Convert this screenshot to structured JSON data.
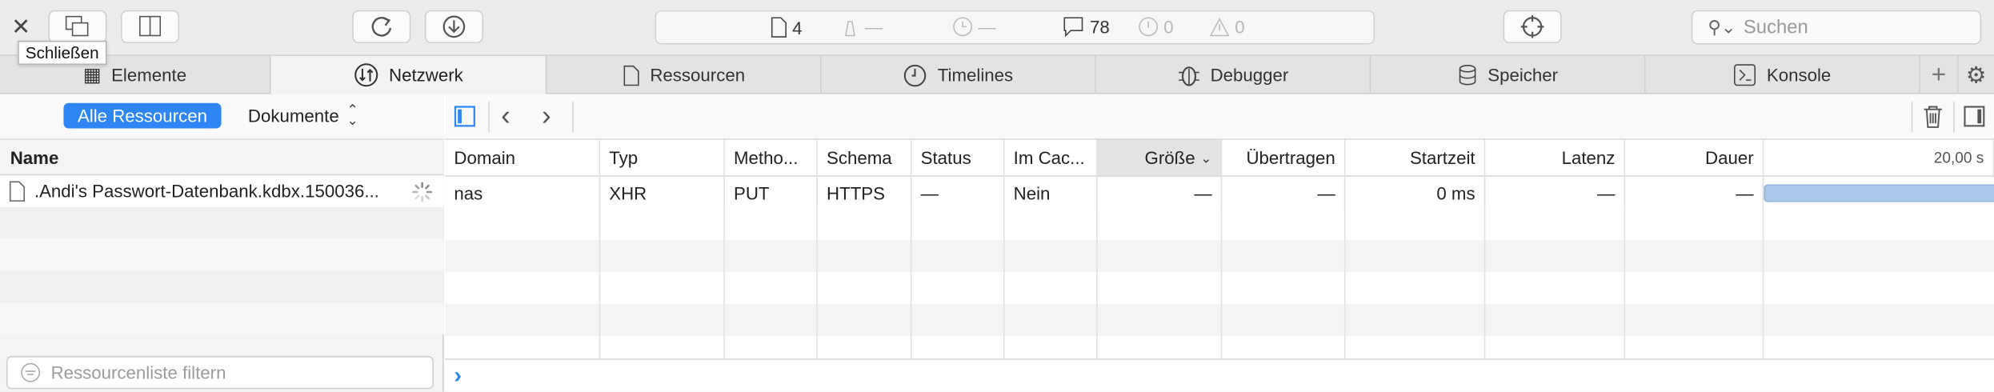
{
  "tooltip": "Schließen",
  "toolbar": {
    "dashboard": {
      "resource_count": "4",
      "size": "—",
      "time": "—",
      "logs": "78",
      "errors": "0",
      "warnings": "0"
    },
    "search_placeholder": "Suchen"
  },
  "tabs": [
    {
      "label": "Elemente",
      "icon": "elements-icon"
    },
    {
      "label": "Netzwerk",
      "icon": "network-icon",
      "active": true
    },
    {
      "label": "Ressourcen",
      "icon": "document-icon"
    },
    {
      "label": "Timelines",
      "icon": "clock-icon"
    },
    {
      "label": "Debugger",
      "icon": "bug-icon"
    },
    {
      "label": "Speicher",
      "icon": "database-icon"
    },
    {
      "label": "Konsole",
      "icon": "console-icon"
    }
  ],
  "scope": {
    "all_label": "Alle Ressourcen",
    "type_label": "Dokumente"
  },
  "sidebar": {
    "header": "Name",
    "items": [
      {
        "name": ".Andi's Passwort-Datenbank.kdbx.150036..."
      }
    ],
    "filter_placeholder": "Ressourcenliste filtern"
  },
  "table": {
    "columns": [
      "Domain",
      "Typ",
      "Metho...",
      "Schema",
      "Status",
      "Im Cac...",
      "Größe",
      "Übertragen",
      "Startzeit",
      "Latenz",
      "Dauer"
    ],
    "timeline_label": "20,00 s",
    "rows": [
      {
        "domain": "nas",
        "typ": "XHR",
        "method": "PUT",
        "schema": "HTTPS",
        "status": "—",
        "cache": "Nein",
        "size": "—",
        "transferred": "—",
        "start": "0 ms",
        "latency": "—",
        "duration": "—"
      }
    ]
  },
  "colors": {
    "accent": "#2e86f5",
    "waterfall_bar": "#a9c8ea"
  }
}
